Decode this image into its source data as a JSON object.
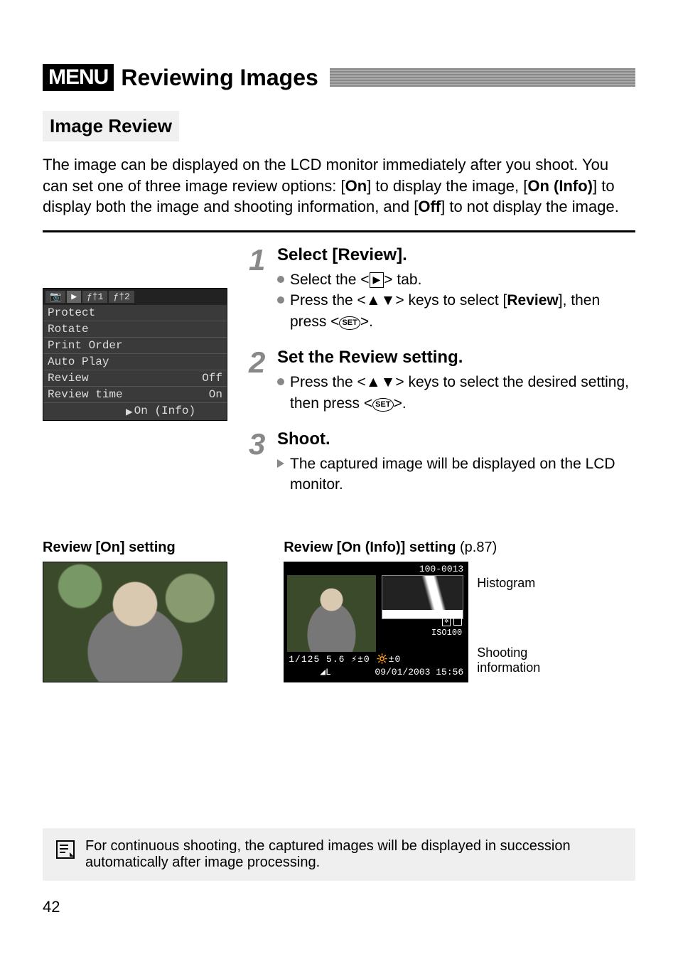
{
  "title": {
    "badge": "MENU",
    "text": "Reviewing Images"
  },
  "subheading": "Image Review",
  "intro": "The image can be displayed on the LCD monitor immediately after you shoot. You can set one of three image review options: [On] to display the image, [On (Info)] to display both the image and shooting information, and [Off] to not display the image.",
  "lcd": {
    "tabs": [
      "📷",
      "▶",
      "ƒ†1",
      "ƒ†2"
    ],
    "rows": [
      {
        "label": "Protect",
        "value": ""
      },
      {
        "label": "Rotate",
        "value": ""
      },
      {
        "label": "Print Order",
        "value": ""
      },
      {
        "label": "Auto Play",
        "value": ""
      },
      {
        "label": "Review",
        "value": "Off"
      },
      {
        "label": "Review time",
        "value": "On"
      }
    ],
    "selected": "On (Info)"
  },
  "steps": [
    {
      "num": "1",
      "title": "Select [Review].",
      "lines": [
        {
          "bullet": "dot",
          "text": "Select the <▶> tab."
        },
        {
          "bullet": "dot",
          "text": "Press the <▲▼> keys to select [Review], then press <SET>."
        }
      ]
    },
    {
      "num": "2",
      "title": "Set the Review setting.",
      "lines": [
        {
          "bullet": "dot",
          "text": "Press the <▲▼> keys to select the desired setting, then press <SET>."
        }
      ]
    },
    {
      "num": "3",
      "title": "Shoot.",
      "lines": [
        {
          "bullet": "tri",
          "text": "The captured image will be displayed on the LCD monitor."
        }
      ]
    }
  ],
  "examples": {
    "on_caption": "Review [On] setting",
    "info_caption_bold": "Review [On (Info)] setting",
    "info_caption_light": " (p.87)",
    "info_overlay": {
      "file_no": "100-0013",
      "iso": "ISO100",
      "line1": "1/125  5.6  ⚡±0 🔆±0",
      "quality": "◢L",
      "datetime": "09/01/2003 15:56"
    },
    "ann_histogram": "Histogram",
    "ann_shooting": "Shooting information"
  },
  "footnote": "For continuous shooting, the captured images will be displayed in succession automatically after image processing.",
  "page_number": "42"
}
